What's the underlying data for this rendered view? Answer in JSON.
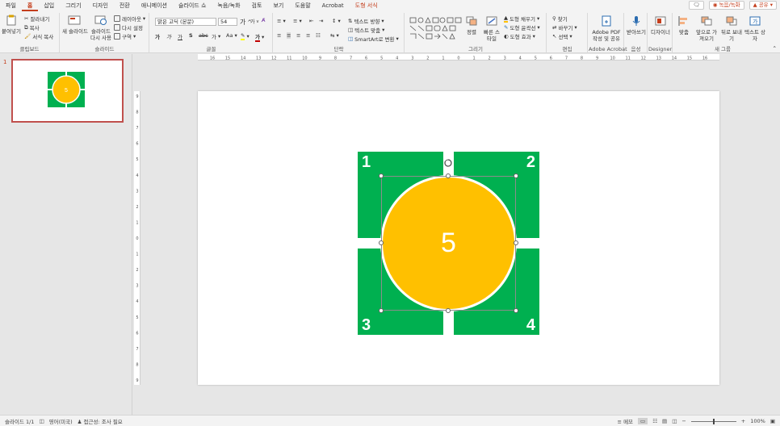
{
  "menu": {
    "tabs": [
      "파일",
      "홈",
      "삽입",
      "그리기",
      "디자인",
      "전환",
      "애니메이션",
      "슬라이드 쇼",
      "녹음/녹화",
      "검토",
      "보기",
      "도움말",
      "Acrobat",
      "도형 서식"
    ],
    "active_tab": "홈",
    "record_button": "녹음/녹화",
    "share_button": "공유"
  },
  "ribbon": {
    "clipboard": {
      "paste": "붙여넣기",
      "cut": "잘라내기",
      "copy": "복사",
      "format_painter": "서식 복사",
      "label": "클립보드"
    },
    "slides": {
      "new_slide": "새 슬라이드",
      "reuse": "슬라이드 다시 사용",
      "layout": "레이아웃",
      "reset": "다시 설정",
      "section": "구역",
      "label": "슬라이드"
    },
    "font": {
      "name": "맑은 고딕 (본문)",
      "size": "54",
      "grow": "가",
      "shrink": "가",
      "label": "글꼴",
      "bold": "가",
      "italic": "가",
      "underline": "가",
      "strike": "S",
      "spacing": "가",
      "case": "Aa"
    },
    "paragraph": {
      "text_direction": "텍스트 방향",
      "align_text": "텍스트 맞춤",
      "smartart": "SmartArt로 변환",
      "label": "단락"
    },
    "drawing": {
      "arrange": "정렬",
      "quick_styles": "빠른 스타일",
      "fill": "도형 채우기",
      "outline": "도형 윤곽선",
      "effects": "도형 효과",
      "label": "그리기"
    },
    "editing": {
      "find": "찾기",
      "replace": "바꾸기",
      "select": "선택",
      "label": "편집"
    },
    "acrobat": {
      "create": "Adobe PDF 작성 및 공유",
      "label": "Adobe Acrobat"
    },
    "voice": {
      "dictate": "받아쓰기",
      "label": "음성"
    },
    "designer": {
      "design": "디자이너",
      "label": "Designer"
    },
    "group": {
      "align": "맞춤",
      "bring_forward": "앞으로 가져오기",
      "send_back": "뒤로 보내기",
      "textbox": "텍스트 상자",
      "label": "새 그룹"
    }
  },
  "thumbnail": {
    "number": "1"
  },
  "slide": {
    "tiles": [
      "1",
      "2",
      "3",
      "4"
    ],
    "center_label": "5",
    "tile_color": "#00b050",
    "circle_color": "#ffc000"
  },
  "ruler": {
    "h_ticks": [
      "16",
      "15",
      "14",
      "13",
      "12",
      "11",
      "10",
      "9",
      "8",
      "7",
      "6",
      "5",
      "4",
      "3",
      "2",
      "1",
      "0",
      "1",
      "2",
      "3",
      "4",
      "5",
      "6",
      "7",
      "8",
      "9",
      "10",
      "11",
      "12",
      "13",
      "14",
      "15",
      "16"
    ],
    "v_ticks": [
      "9",
      "8",
      "7",
      "6",
      "5",
      "4",
      "3",
      "2",
      "1",
      "0",
      "1",
      "2",
      "3",
      "4",
      "5",
      "6",
      "7",
      "8",
      "9"
    ]
  },
  "status": {
    "slide_count": "슬라이드 1/1",
    "language": "영어(미국)",
    "accessibility": "접근성: 조사 필요",
    "notes": "메모",
    "zoom": "100%"
  }
}
